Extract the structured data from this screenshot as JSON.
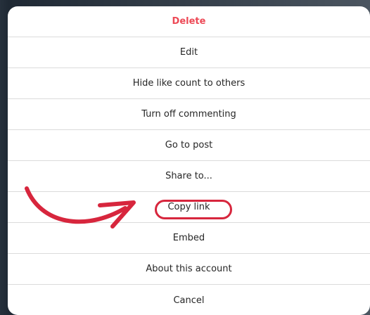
{
  "menu": {
    "items": [
      {
        "label": "Delete",
        "style": "danger"
      },
      {
        "label": "Edit"
      },
      {
        "label": "Hide like count to others"
      },
      {
        "label": "Turn off commenting"
      },
      {
        "label": "Go to post"
      },
      {
        "label": "Share to..."
      },
      {
        "label": "Copy link",
        "highlighted": true
      },
      {
        "label": "Embed"
      },
      {
        "label": "About this account"
      },
      {
        "label": "Cancel"
      }
    ]
  },
  "colors": {
    "danger": "#ed4956",
    "annotation": "#d7263d",
    "text": "#262626",
    "divider": "#dbdbdb"
  },
  "annotation": {
    "arrow_icon": "curved-arrow-icon",
    "target": "Copy link"
  }
}
